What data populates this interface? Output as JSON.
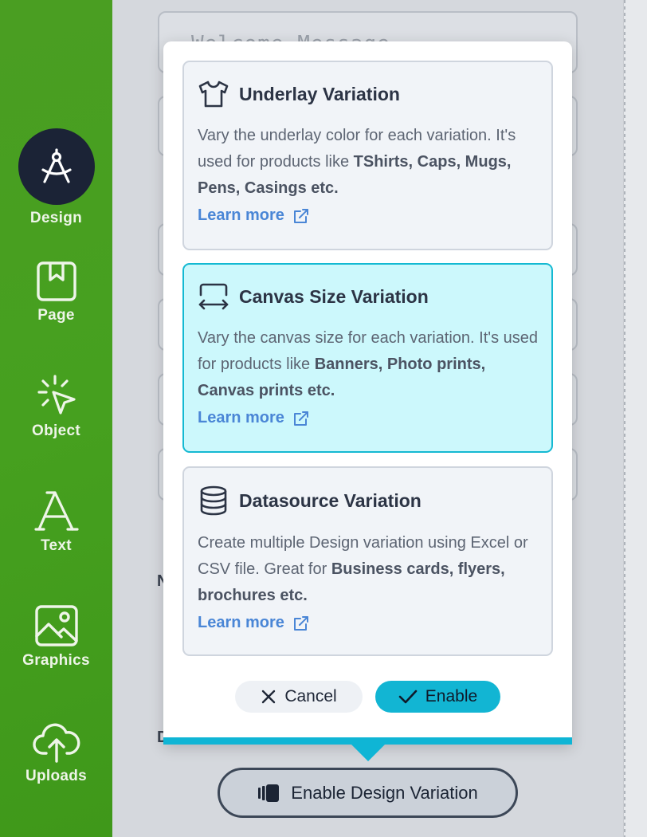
{
  "sidebar": {
    "items": [
      {
        "label": "Design",
        "icon": "compass-icon",
        "active": true
      },
      {
        "label": "Page",
        "icon": "bookmark-icon"
      },
      {
        "label": "Object",
        "icon": "cursor-click-icon"
      },
      {
        "label": "Text",
        "icon": "letter-a-icon"
      },
      {
        "label": "Graphics",
        "icon": "image-icon"
      },
      {
        "label": "Uploads",
        "icon": "cloud-upload-icon"
      }
    ]
  },
  "background": {
    "ghost_field_text": "Welcome Message",
    "fragment_m": "N",
    "fragment_d": "D"
  },
  "popup": {
    "cards": [
      {
        "title": "Underlay Variation",
        "icon": "tshirt-icon",
        "desc_plain": "Vary the underlay color for each variation. It's used for products like ",
        "desc_bold": "TShirts, Caps, Mugs, Pens, Casings etc.",
        "learn_more": "Learn more"
      },
      {
        "title": "Canvas Size Variation",
        "icon": "canvas-resize-icon",
        "desc_plain": "Vary the canvas size for each variation. It's used for products like ",
        "desc_bold": "Banners, Photo prints, Canvas prints etc.",
        "learn_more": "Learn more",
        "selected": true
      },
      {
        "title": "Datasource Variation",
        "icon": "database-icon",
        "desc_plain": "Create multiple Design variation using Excel or CSV file. Great for ",
        "desc_bold": "Business cards, flyers, brochures etc.",
        "learn_more": "Learn more"
      }
    ],
    "cancel_label": "Cancel",
    "enable_label": "Enable"
  },
  "enable_design_variation_label": "Enable Design Variation",
  "colors": {
    "sidebar_green": "#46a01f",
    "active_bubble": "#1b2336",
    "accent_cyan": "#12b5d3",
    "selected_card_bg": "#ccf8fc",
    "link_blue": "#4a86d6"
  }
}
